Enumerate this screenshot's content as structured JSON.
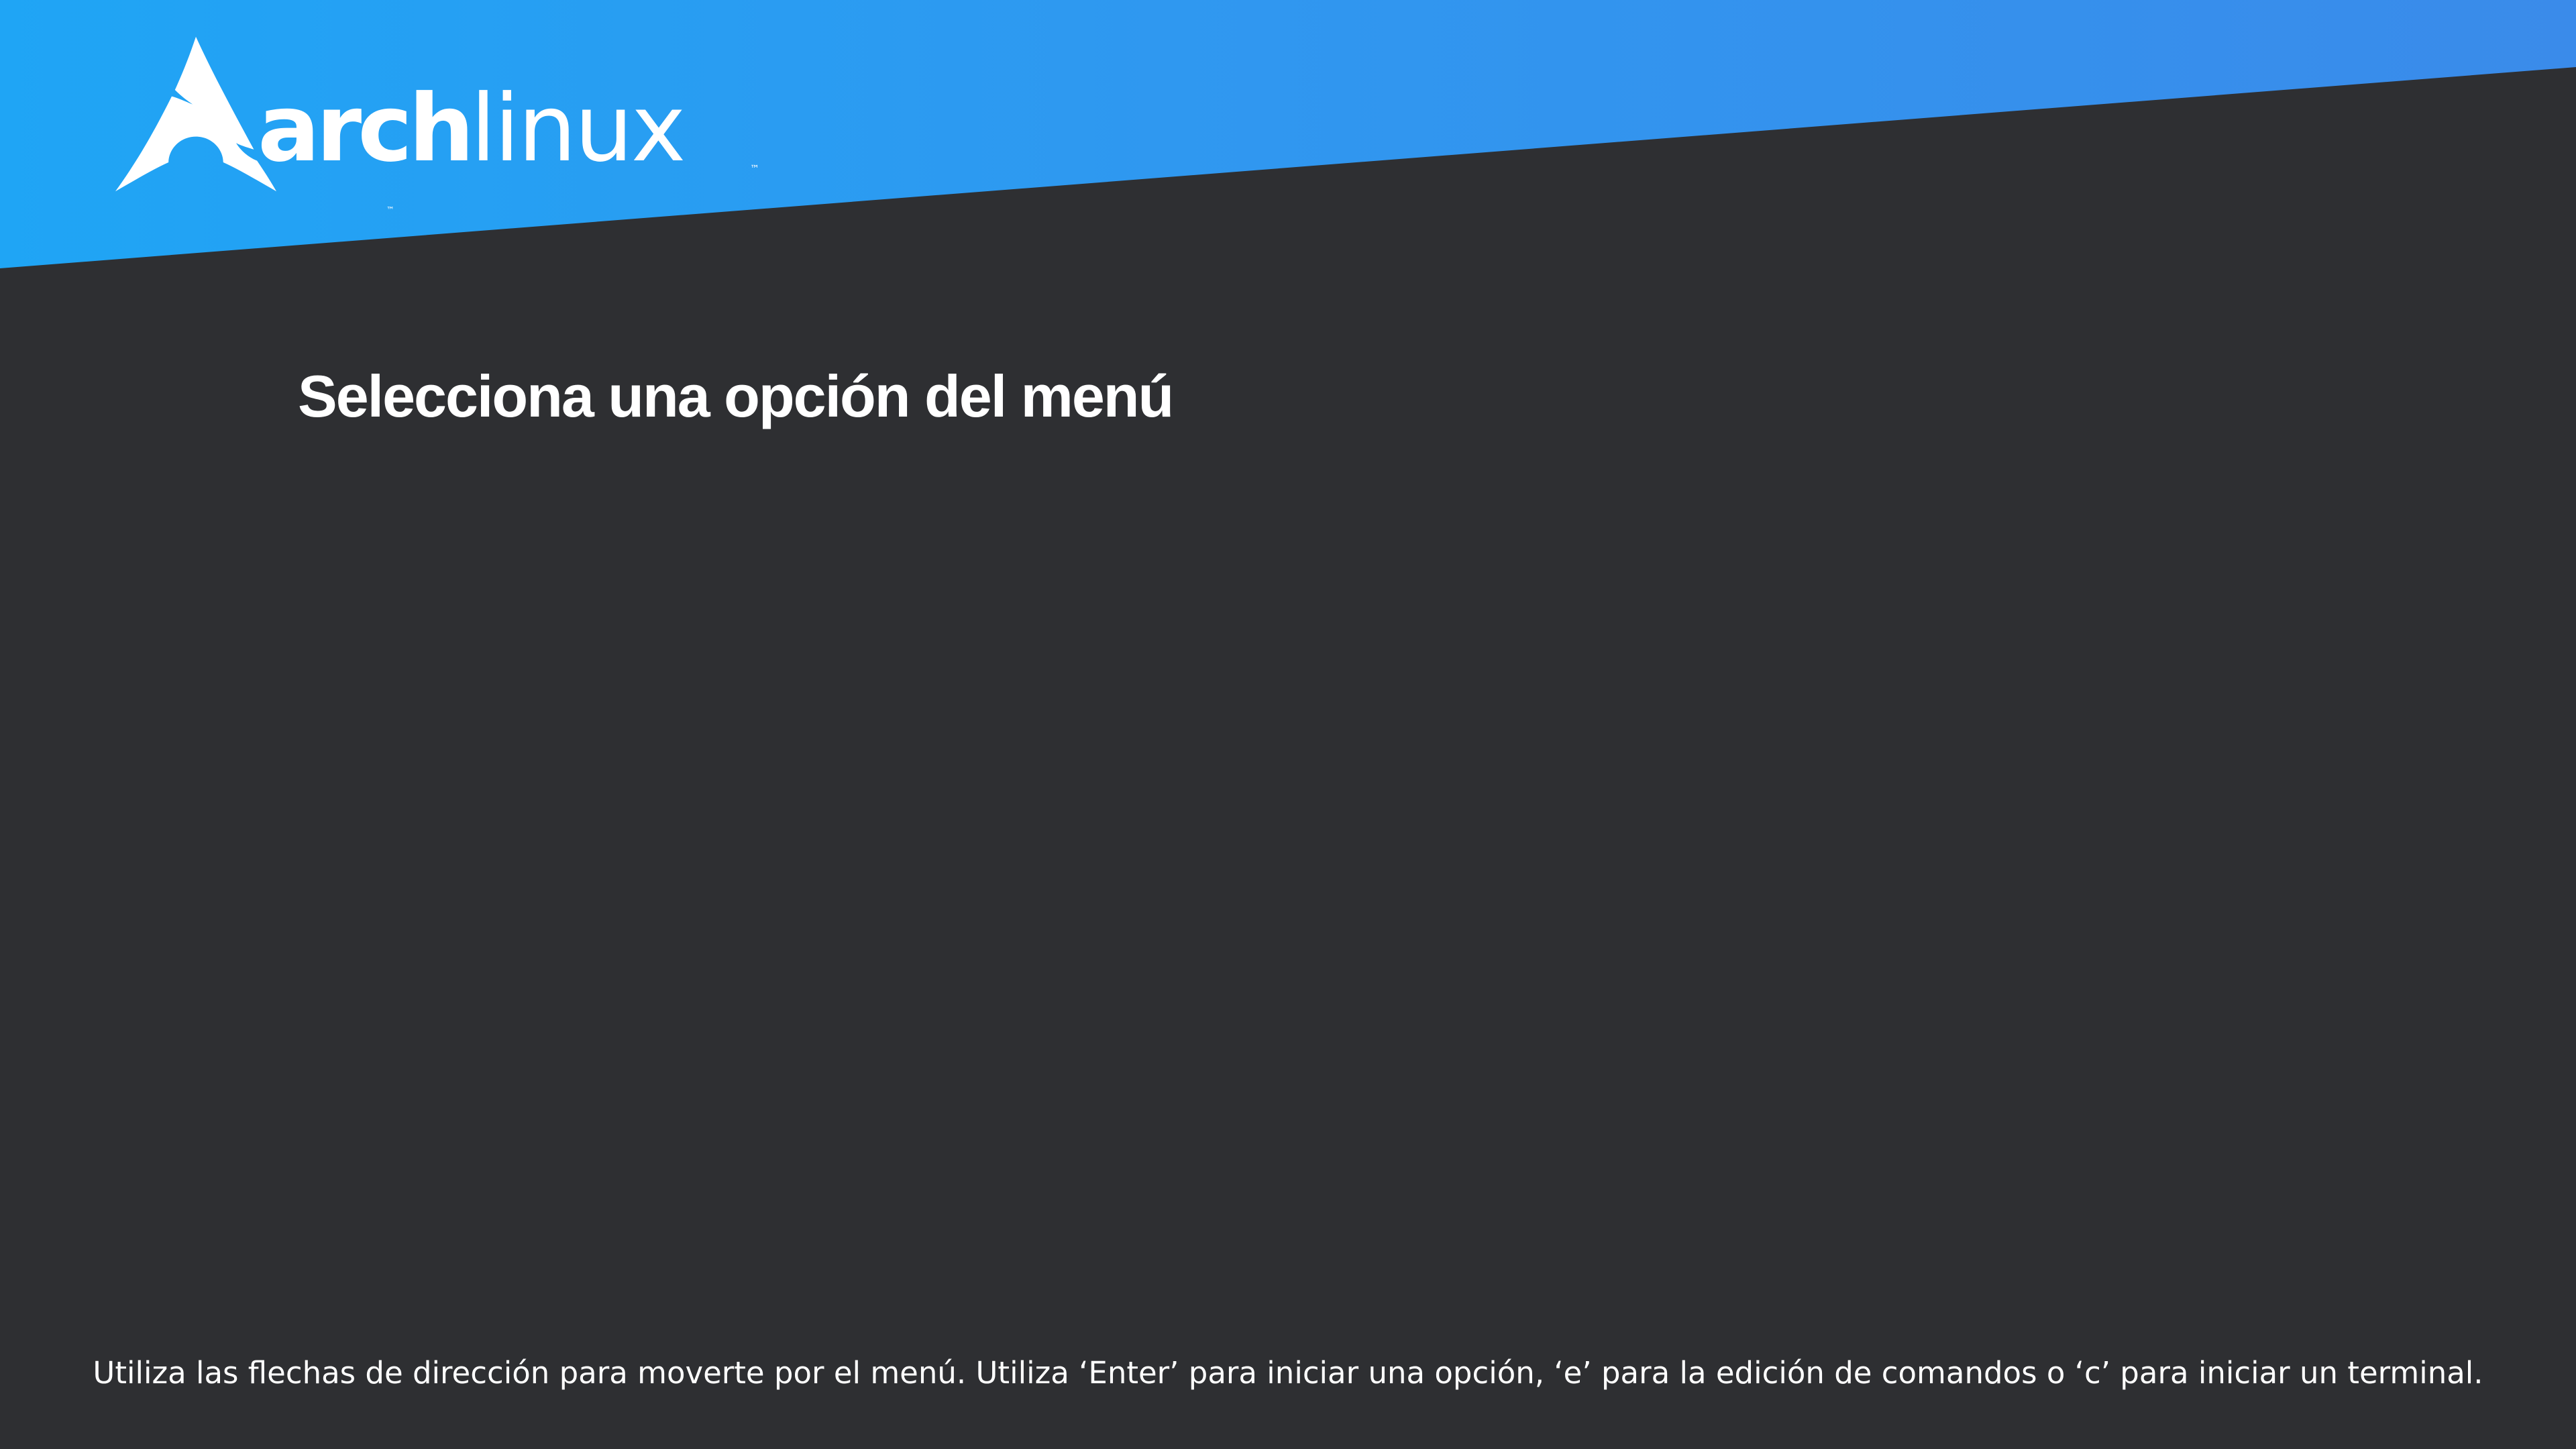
{
  "header": {
    "logo": {
      "word_bold": "arch",
      "word_light": "linux",
      "trademark": "™",
      "icon": "arch-linux-logo-icon",
      "color": "#ffffff"
    },
    "banner_colors": [
      "#1fa5f5",
      "#3a8bea"
    ]
  },
  "menu": {
    "title": "Selecciona una opción del menú",
    "entries": []
  },
  "footer": {
    "help": "Utiliza las flechas de dirección para moverte por el menú. Utiliza ‘Enter’ para iniciar una opción, ‘e’ para la edición de comandos o ‘c’ para iniciar un terminal."
  },
  "theme": {
    "background": "#2e2f32",
    "text": "#ffffff"
  }
}
